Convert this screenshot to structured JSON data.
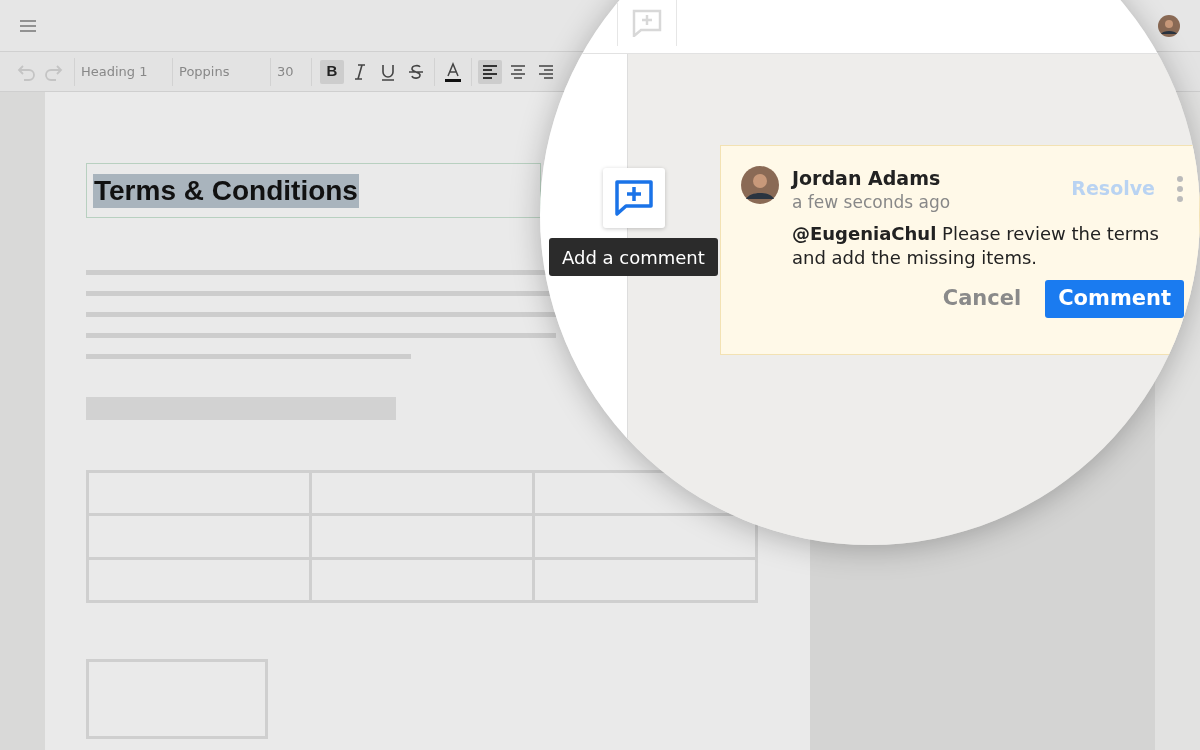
{
  "toolbar": {
    "history": [
      {
        "kind": "undo",
        "disabled": true
      },
      {
        "kind": "redo",
        "disabled": true
      }
    ],
    "style": "Heading 1",
    "font": "Poppins",
    "size": "30",
    "format": [
      {
        "kind": "bold",
        "label": "B",
        "selected": true
      },
      {
        "kind": "italic",
        "selected": false
      },
      {
        "kind": "underline",
        "selected": false
      },
      {
        "kind": "strike",
        "selected": false
      },
      {
        "kind": "color",
        "selected": false
      },
      {
        "kind": "align-left",
        "selected": true
      },
      {
        "kind": "align-center",
        "selected": false
      },
      {
        "kind": "align-right",
        "selected": false
      }
    ]
  },
  "document": {
    "heading": "Terms & Conditions",
    "heading_selected": true
  },
  "tooltip": "Add a comment",
  "comment": {
    "author": "Jordan Adams",
    "time": "a few seconds ago",
    "resolve": "Resolve",
    "text": "**@EugeniaChul** Please review the terms and add the missing items.",
    "buttons": [
      "Cancel",
      "Comment"
    ]
  }
}
